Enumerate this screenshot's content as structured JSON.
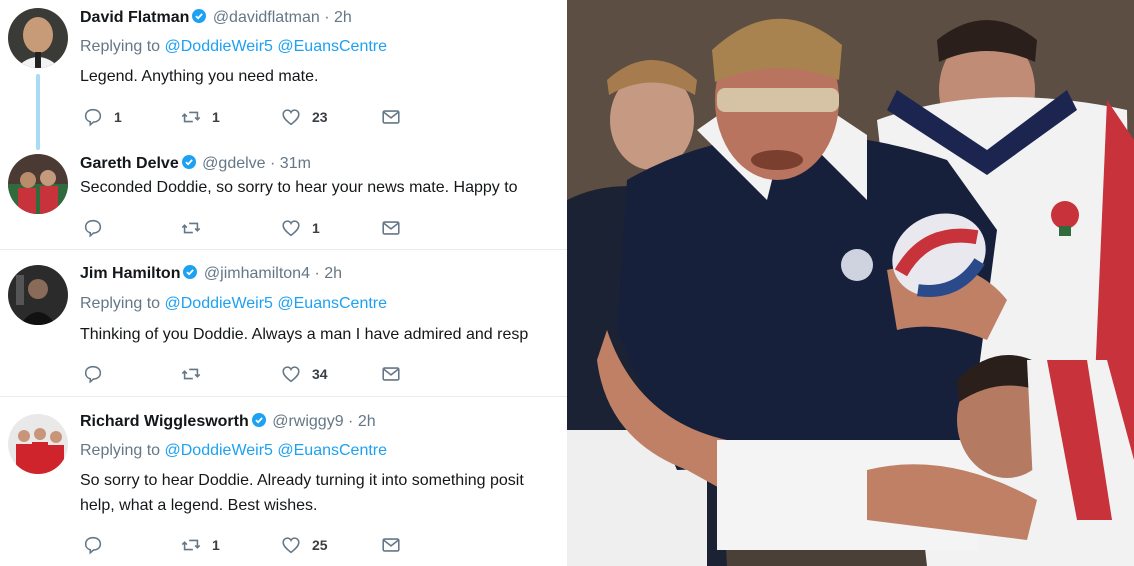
{
  "tweets": [
    {
      "name": "David Flatman",
      "handle": "@davidflatman",
      "time": "2h",
      "replying_prefix": "Replying to",
      "mentions": [
        "@DoddieWeir5",
        "@EuansCentre"
      ],
      "text_lines": [
        "Legend. Anything you need mate."
      ],
      "counts": {
        "replies": "1",
        "retweets": "1",
        "likes": "23"
      }
    },
    {
      "name": "Gareth Delve",
      "handle": "@gdelve",
      "time": "31m",
      "text_lines": [
        "Seconded Doddie, so sorry to hear your news mate. Happy to"
      ],
      "counts": {
        "replies": "",
        "retweets": "",
        "likes": "1"
      }
    },
    {
      "name": "Jim Hamilton",
      "handle": "@jimhamilton4",
      "time": "2h",
      "replying_prefix": "Replying to",
      "mentions": [
        "@DoddieWeir5",
        "@EuansCentre"
      ],
      "text_lines": [
        "Thinking of you Doddie. Always a man I have admired and resp"
      ],
      "counts": {
        "replies": "",
        "retweets": "",
        "likes": "34"
      }
    },
    {
      "name": "Richard Wigglesworth",
      "handle": "@rwiggy9",
      "time": "2h",
      "replying_prefix": "Replying to",
      "mentions": [
        "@DoddieWeir5",
        "@EuansCentre"
      ],
      "text_lines": [
        "So sorry to hear Doddie. Already turning it into something posit",
        "help, what a legend. Best wishes."
      ],
      "counts": {
        "replies": "",
        "retweets": "1",
        "likes": "25"
      }
    }
  ],
  "separator": "·",
  "icons": [
    "verified-badge-icon",
    "reply-icon",
    "retweet-icon",
    "like-icon",
    "direct-message-icon"
  ],
  "colors": {
    "mention": "#1da1f2",
    "verified": "#1da1f2",
    "muted": "#657786",
    "thread_line": "#a7dbf6"
  },
  "photo": {
    "description_icon": "rugby-match-photo"
  }
}
